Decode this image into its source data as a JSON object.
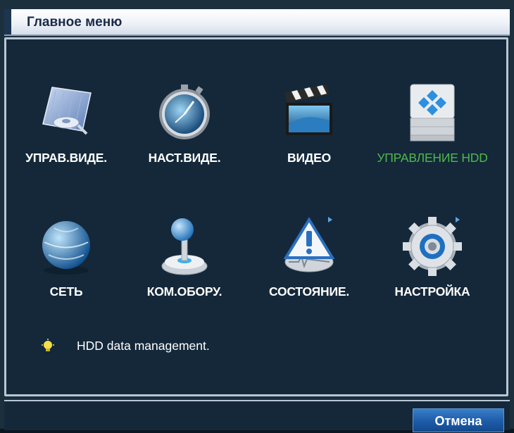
{
  "window": {
    "title": "Главное меню"
  },
  "menu": {
    "row1": [
      {
        "label": "УПРАВ.ВИДЕ.",
        "icon": "video-management-icon"
      },
      {
        "label": "НАСТ.ВИДЕ.",
        "icon": "video-settings-icon"
      },
      {
        "label": "ВИДЕО",
        "icon": "clapperboard-icon"
      },
      {
        "label": "УПРАВЛЕНИЕ HDD",
        "icon": "hdd-icon",
        "selected": true
      }
    ],
    "row2": [
      {
        "label": "СЕТЬ",
        "icon": "globe-icon"
      },
      {
        "label": "КОМ.ОБОРУ.",
        "icon": "joystick-icon"
      },
      {
        "label": "СОСТОЯНИЕ.",
        "icon": "warning-icon"
      },
      {
        "label": "НАСТРОЙКА",
        "icon": "gear-icon"
      }
    ]
  },
  "hint": {
    "text": "HDD data management."
  },
  "footer": {
    "cancel_label": "Отмена"
  },
  "colors": {
    "selected_label": "#4fb84a",
    "panel_bg": "#14283a",
    "button_blue": "#1c5ba8"
  }
}
